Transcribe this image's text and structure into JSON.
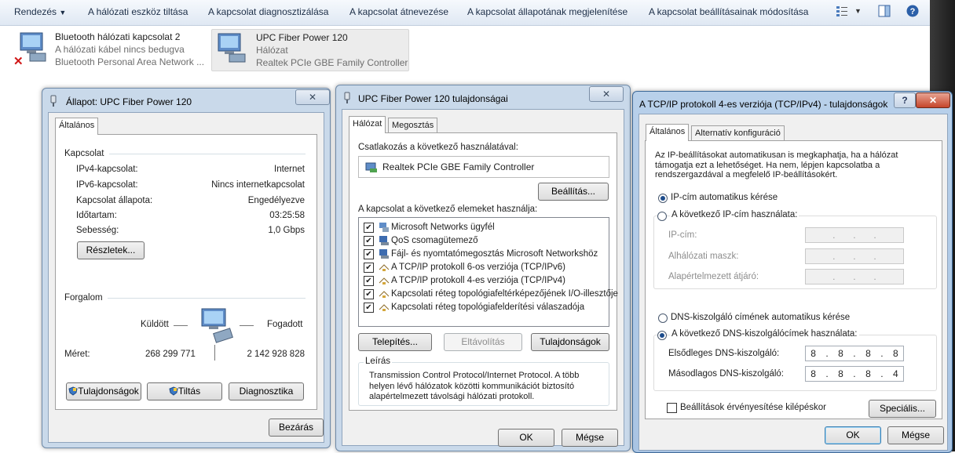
{
  "toolbar": {
    "organize": "Rendezés",
    "items": [
      "A hálózati eszköz tiltása",
      "A kapcsolat diagnosztizálása",
      "A kapcsolat átnevezése",
      "A kapcsolat állapotának megjelenítése",
      "A kapcsolat beállításainak módosítása"
    ]
  },
  "connections": [
    {
      "name": "Bluetooth hálózati kapcsolat 2",
      "status": "A hálózati kábel nincs bedugva",
      "device": "Bluetooth Personal Area Network ..."
    },
    {
      "name": "UPC Fiber Power 120",
      "status": "Hálózat",
      "device": "Realtek PCIe GBE Family Controller"
    }
  ],
  "status_dialog": {
    "title": "Állapot: UPC Fiber Power 120",
    "tab": "Általános",
    "section_connection": "Kapcsolat",
    "rows": [
      {
        "label": "IPv4-kapcsolat:",
        "value": "Internet"
      },
      {
        "label": "IPv6-kapcsolat:",
        "value": "Nincs internetkapcsolat"
      },
      {
        "label": "Kapcsolat állapota:",
        "value": "Engedélyezve"
      },
      {
        "label": "Időtartam:",
        "value": "03:25:58"
      },
      {
        "label": "Sebesség:",
        "value": "1,0 Gbps"
      }
    ],
    "details_btn": "Részletek...",
    "section_traffic": "Forgalom",
    "sent": "Küldött",
    "received": "Fogadott",
    "size_label": "Méret:",
    "sent_value": "268 299 771",
    "received_value": "2 142 928 828",
    "btn_properties": "Tulajdonságok",
    "btn_disable": "Tiltás",
    "btn_diagnose": "Diagnosztika",
    "btn_close": "Bezárás"
  },
  "props_dialog": {
    "title": "UPC Fiber Power 120 tulajdonságai",
    "tabs": [
      "Hálózat",
      "Megosztás"
    ],
    "connect_using": "Csatlakozás a következő használatával:",
    "adapter": "Realtek PCIe GBE Family Controller",
    "configure_btn": "Beállítás...",
    "items_label": "A kapcsolat a következő elemeket használja:",
    "items": [
      "Microsoft Networks ügyfél",
      "QoS csomagütemező",
      "Fájl- és nyomtatómegosztás Microsoft Networkshöz",
      "A TCP/IP protokoll 6-os verziója (TCP/IPv6)",
      "A TCP/IP protokoll 4-es verziója (TCP/IPv4)",
      "Kapcsolati réteg topológiafeltérképezőjének I/O-illesztője",
      "Kapcsolati réteg topológiafelderítési válaszadója"
    ],
    "install_btn": "Telepítés...",
    "uninstall_btn": "Eltávolítás",
    "properties_btn": "Tulajdonságok",
    "desc_caption": "Leírás",
    "description": "Transmission Control Protocol/Internet Protocol. A több helyen lévő hálózatok közötti kommunikációt biztosító alapértelmezett távolsági hálózati protokoll.",
    "ok": "OK",
    "cancel": "Mégse"
  },
  "ipv4_dialog": {
    "title": "A TCP/IP protokoll 4-es verziója (TCP/IPv4) - tulajdonságok",
    "tabs": [
      "Általános",
      "Alternatív konfiguráció"
    ],
    "intro": "Az IP-beállításokat automatikusan is megkaphatja, ha a hálózat támogatja ezt a lehetőséget. Ha nem, lépjen kapcsolatba a rendszergazdával a megfelelő IP-beállításokért.",
    "auto_ip": "IP-cím automatikus kérése",
    "manual_ip": "A következő IP-cím használata:",
    "ip_label": "IP-cím:",
    "mask_label": "Alhálózati maszk:",
    "gateway_label": "Alapértelmezett átjáró:",
    "auto_dns": "DNS-kiszolgáló címének automatikus kérése",
    "manual_dns": "A következő DNS-kiszolgálócímek használata:",
    "dns1_label": "Elsődleges DNS-kiszolgáló:",
    "dns1": [
      "8",
      "8",
      "8",
      "8"
    ],
    "dns2_label": "Másodlagos DNS-kiszolgáló:",
    "dns2": [
      "8",
      "8",
      "8",
      "4"
    ],
    "validate": "Beállítások érvényesítése kilépéskor",
    "advanced_btn": "Speciális...",
    "ok": "OK",
    "cancel": "Mégse"
  }
}
